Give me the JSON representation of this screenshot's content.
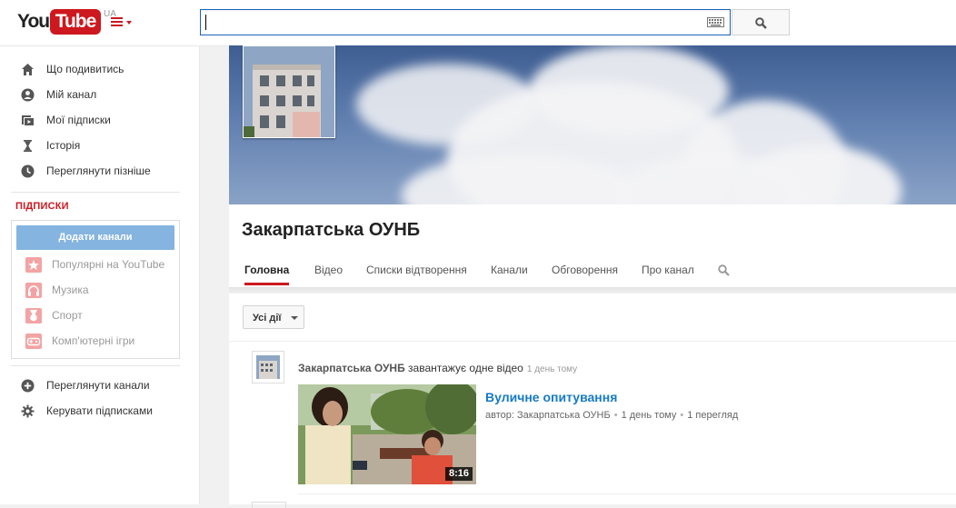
{
  "header": {
    "logo_you": "You",
    "logo_tube": "Tube",
    "logo_region": "UA",
    "search_value": "",
    "search_placeholder": ""
  },
  "guide": {
    "main_items": [
      {
        "label": "Що подивитись",
        "icon": "home-icon"
      },
      {
        "label": "Мій канал",
        "icon": "user-icon"
      },
      {
        "label": "Мої підписки",
        "icon": "subscriptions-icon"
      },
      {
        "label": "Історія",
        "icon": "hourglass-icon"
      },
      {
        "label": "Переглянути пізніше",
        "icon": "clock-icon"
      }
    ],
    "subscriptions_heading": "ПІДПИСКИ",
    "add_channels_label": "Додати канали",
    "subscription_items": [
      {
        "label": "Популярні на YouTube",
        "icon": "star-icon"
      },
      {
        "label": "Музика",
        "icon": "headphones-icon"
      },
      {
        "label": "Спорт",
        "icon": "medal-icon"
      },
      {
        "label": "Комп'ютерні ігри",
        "icon": "gamepad-icon"
      }
    ],
    "bottom_items": [
      {
        "label": "Переглянути канали",
        "icon": "plus-circle-icon"
      },
      {
        "label": "Керувати підписками",
        "icon": "gear-icon"
      }
    ]
  },
  "channel": {
    "title": "Закарпатська ОУНБ",
    "tabs": [
      "Головна",
      "Відео",
      "Списки відтворення",
      "Канали",
      "Обговорення",
      "Про канал"
    ],
    "active_tab": "Головна"
  },
  "feed": {
    "filter_label": "Усі дії",
    "item": {
      "author": "Закарпатська ОУНБ",
      "action": " завантажує одне відео",
      "time": "1 день тому",
      "video_title": "Вуличне опитування",
      "meta_author": "автор: Закарпатська ОУНБ",
      "meta_age": "1 день тому",
      "meta_views": "1 перегляд",
      "duration": "8:16"
    }
  },
  "colors": {
    "brand_red": "#cc181e",
    "link_blue": "#167ac6",
    "add_button_blue": "#84b4df",
    "search_border": "#1c62b9"
  }
}
